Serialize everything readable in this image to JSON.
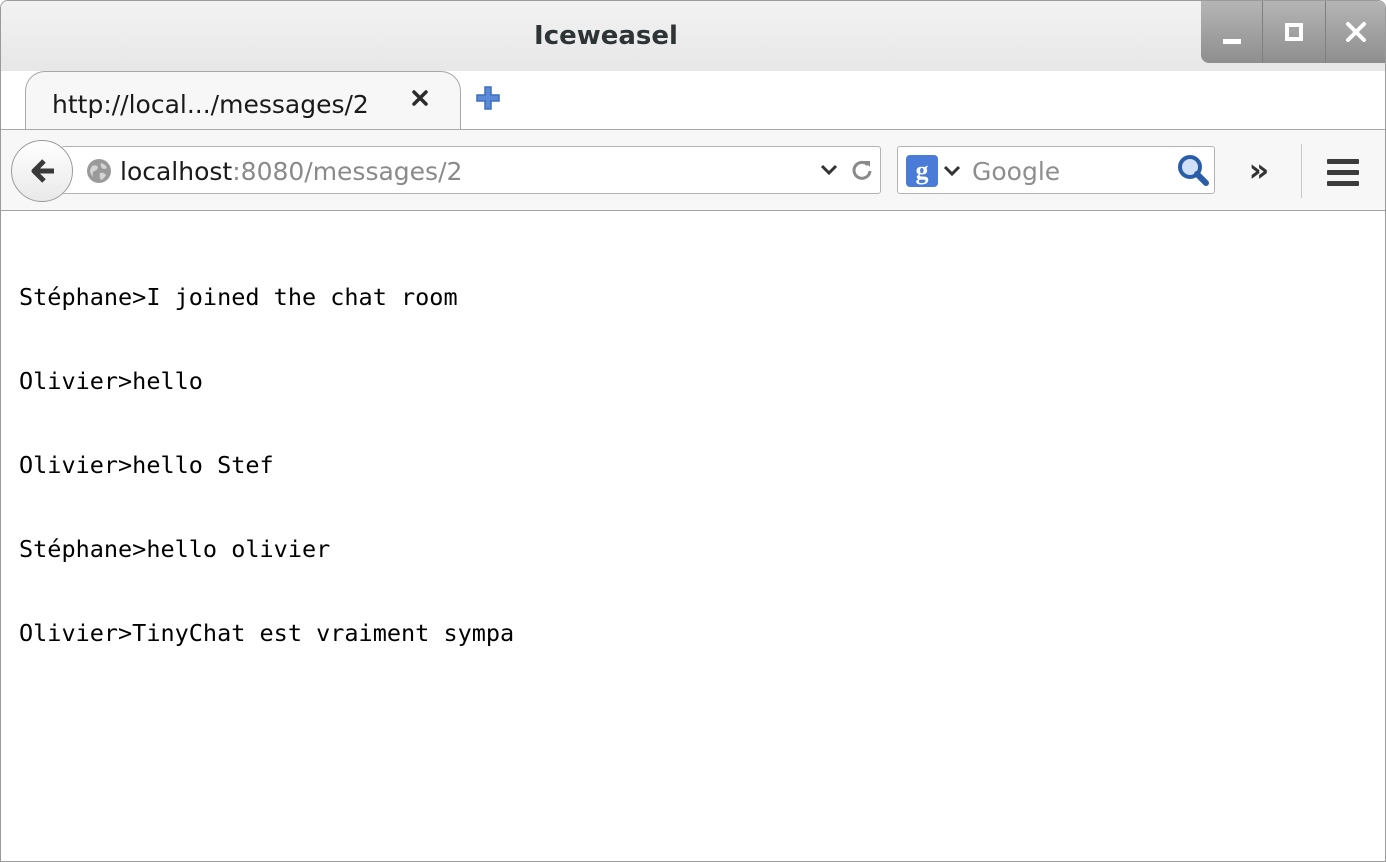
{
  "window": {
    "title": "Iceweasel",
    "controls": [
      "minimize",
      "maximize",
      "close"
    ]
  },
  "tabs": [
    {
      "label": "http://local.../messages/2",
      "active": true
    }
  ],
  "toolbar": {
    "url_host": "localhost",
    "url_rest": ":8080/messages/2",
    "search_placeholder": "Google",
    "search_engine_icon": "google-g-icon",
    "overflow_label": "»"
  },
  "content": {
    "messages": [
      "Stéphane>I joined the chat room",
      "Olivier>hello",
      "Olivier>hello Stef",
      "Stéphane>hello olivier",
      "Olivier>TinyChat est vraiment sympa"
    ]
  },
  "colors": {
    "search_engine": "#4a7bd6",
    "new_tab_icon": "#3d6fbf",
    "magnifier": "#2a5da8"
  }
}
